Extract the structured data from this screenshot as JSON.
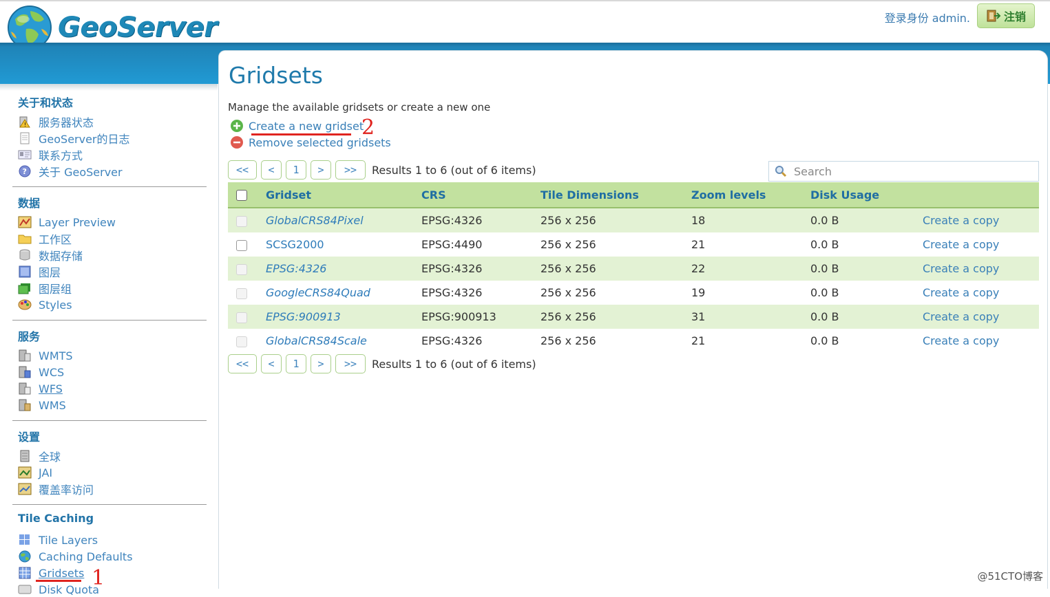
{
  "header": {
    "logo_text": "GeoServer",
    "login_text": "登录身份 admin.",
    "logout_label": "注销"
  },
  "sidebar": {
    "sections": [
      {
        "title": "关于和状态",
        "items": [
          "服务器状态",
          "GeoServer的日志",
          "联系方式",
          "关于 GeoServer"
        ]
      },
      {
        "title": "数据",
        "items": [
          "Layer Preview",
          "工作区",
          "数据存储",
          "图层",
          "图层组",
          "Styles"
        ]
      },
      {
        "title": "服务",
        "items": [
          "WMTS",
          "WCS",
          "WFS",
          "WMS"
        ]
      },
      {
        "title": "设置",
        "items": [
          "全球",
          "JAI",
          "覆盖率访问"
        ]
      },
      {
        "title": "Tile Caching",
        "items": [
          "Tile Layers",
          "Caching Defaults",
          "Gridsets",
          "Disk Quota"
        ]
      }
    ]
  },
  "main": {
    "title": "Gridsets",
    "description": "Manage the available gridsets or create a new one",
    "create_label": "Create a new gridset",
    "remove_label": "Remove selected gridsets",
    "pager": {
      "first": "<<",
      "prev": "<",
      "page": "1",
      "next": ">",
      "last": ">>",
      "results": "Results 1 to 6 (out of 6 items)"
    },
    "search_placeholder": "Search",
    "columns": [
      "Gridset",
      "CRS",
      "Tile Dimensions",
      "Zoom levels",
      "Disk Usage"
    ],
    "rows": [
      {
        "name": "GlobalCRS84Pixel",
        "crs": "EPSG:4326",
        "tile": "256 x 256",
        "zoom": "18",
        "disk": "0.0 B",
        "action": "Create a copy"
      },
      {
        "name": "SCSG2000",
        "crs": "EPSG:4490",
        "tile": "256 x 256",
        "zoom": "21",
        "disk": "0.0 B",
        "action": "Create a copy"
      },
      {
        "name": "EPSG:4326",
        "crs": "EPSG:4326",
        "tile": "256 x 256",
        "zoom": "22",
        "disk": "0.0 B",
        "action": "Create a copy"
      },
      {
        "name": "GoogleCRS84Quad",
        "crs": "EPSG:4326",
        "tile": "256 x 256",
        "zoom": "19",
        "disk": "0.0 B",
        "action": "Create a copy"
      },
      {
        "name": "EPSG:900913",
        "crs": "EPSG:900913",
        "tile": "256 x 256",
        "zoom": "31",
        "disk": "0.0 B",
        "action": "Create a copy"
      },
      {
        "name": "GlobalCRS84Scale",
        "crs": "EPSG:4326",
        "tile": "256 x 256",
        "zoom": "21",
        "disk": "0.0 B",
        "action": "Create a copy"
      }
    ]
  },
  "annotations": {
    "one": "1",
    "two": "2"
  },
  "watermark": "@51CTO博客"
}
